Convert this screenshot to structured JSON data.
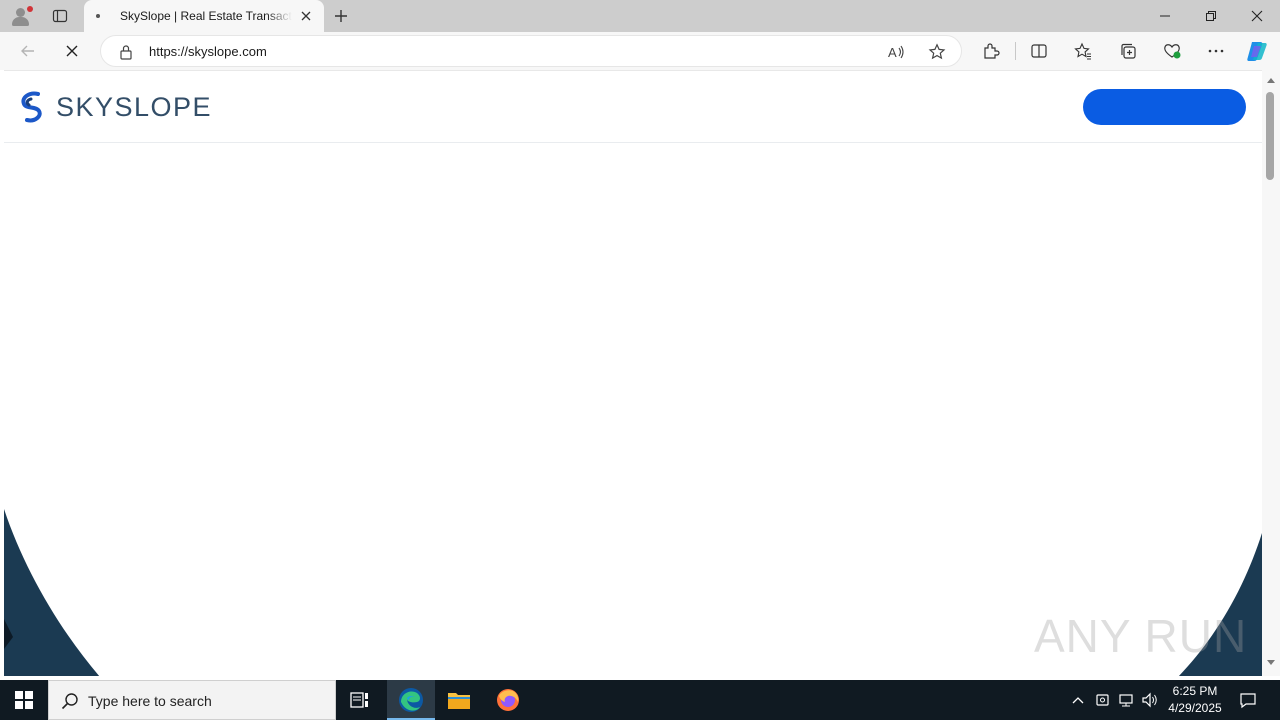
{
  "browser": {
    "tab": {
      "title": "SkySlope | Real Estate Transaction"
    },
    "address": {
      "url": "https://skyslope.com"
    }
  },
  "page": {
    "logo": {
      "wordmark": "SKYSLOPE"
    },
    "cta_button_label": "",
    "colors": {
      "brand_navy": "#1b3a52",
      "brand_blue": "#0a5ce3",
      "logo_text": "#334e68"
    },
    "watermark": "ANY RUN"
  },
  "taskbar": {
    "search_placeholder": "Type here to search",
    "clock": {
      "time": "6:25 PM",
      "date": "4/29/2025"
    }
  }
}
